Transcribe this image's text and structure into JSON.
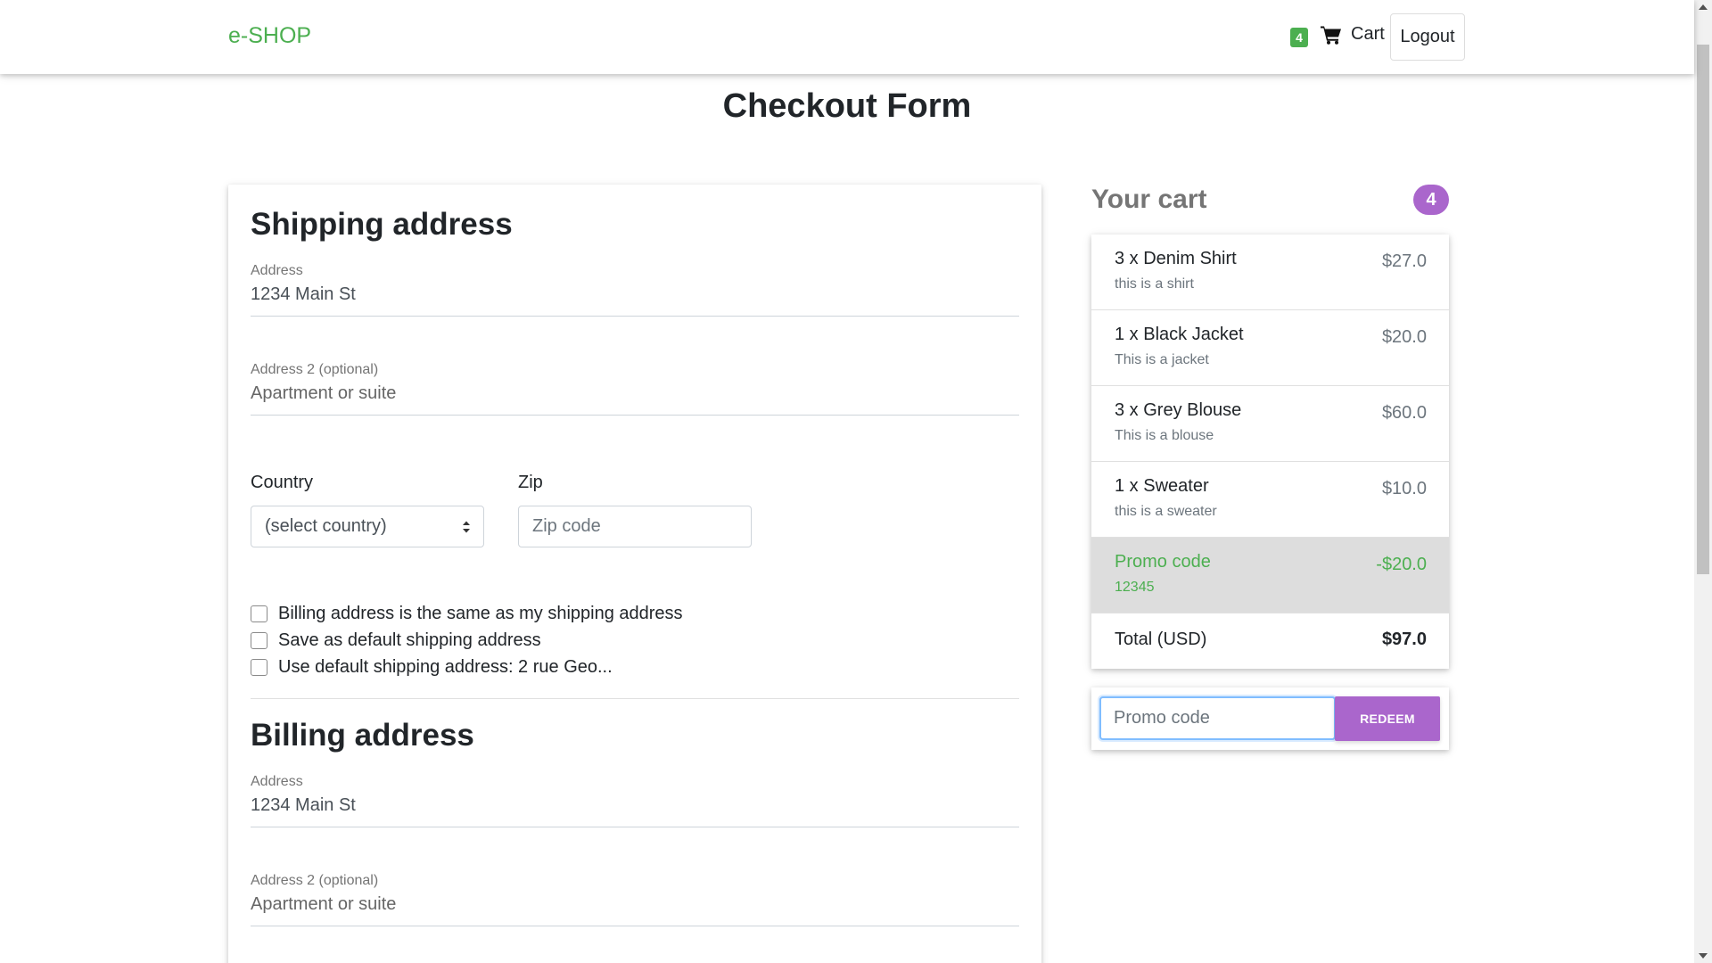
{
  "navbar": {
    "brand": "e-SHOP",
    "cart_badge": "4",
    "cart_label": "Cart",
    "cart_icon": "shopping-cart-icon",
    "logout_label": "Logout"
  },
  "page_title": "Checkout Form",
  "shipping": {
    "title": "Shipping address",
    "address_label": "Address",
    "address_value": "1234 Main St",
    "address2_label": "Address 2 (optional)",
    "address2_placeholder": "Apartment or suite",
    "country_label": "Country",
    "country_selected": "(select country)",
    "zip_label": "Zip",
    "zip_placeholder": "Zip code"
  },
  "options": [
    "Billing address is the same as my shipping address",
    "Save as default shipping address",
    "Use default shipping address: 2 rue Geo..."
  ],
  "billing": {
    "title": "Billing address",
    "address_label": "Address",
    "address_value": "1234 Main St",
    "address2_label": "Address 2 (optional)",
    "address2_placeholder": "Apartment or suite"
  },
  "cart": {
    "title": "Your cart",
    "count": "4",
    "items": [
      {
        "name": "3 x Denim Shirt",
        "desc": "this is a shirt",
        "price": "$27.0"
      },
      {
        "name": "1 x Black Jacket",
        "desc": "This is a jacket",
        "price": "$20.0"
      },
      {
        "name": "3 x Grey Blouse",
        "desc": "This is a blouse",
        "price": "$60.0"
      },
      {
        "name": "1 x Sweater",
        "desc": "this is a sweater",
        "price": "$10.0"
      }
    ],
    "promo": {
      "name": "Promo code",
      "code": "12345",
      "amount": "-$20.0"
    },
    "total_label": "Total (USD)",
    "total_value": "$97.0",
    "promo_placeholder": "Promo code",
    "redeem_label": "REDEEM"
  },
  "colors": {
    "brand": "#4caf50",
    "accent": "#aa66cc",
    "promo_bg": "#dddddd"
  }
}
